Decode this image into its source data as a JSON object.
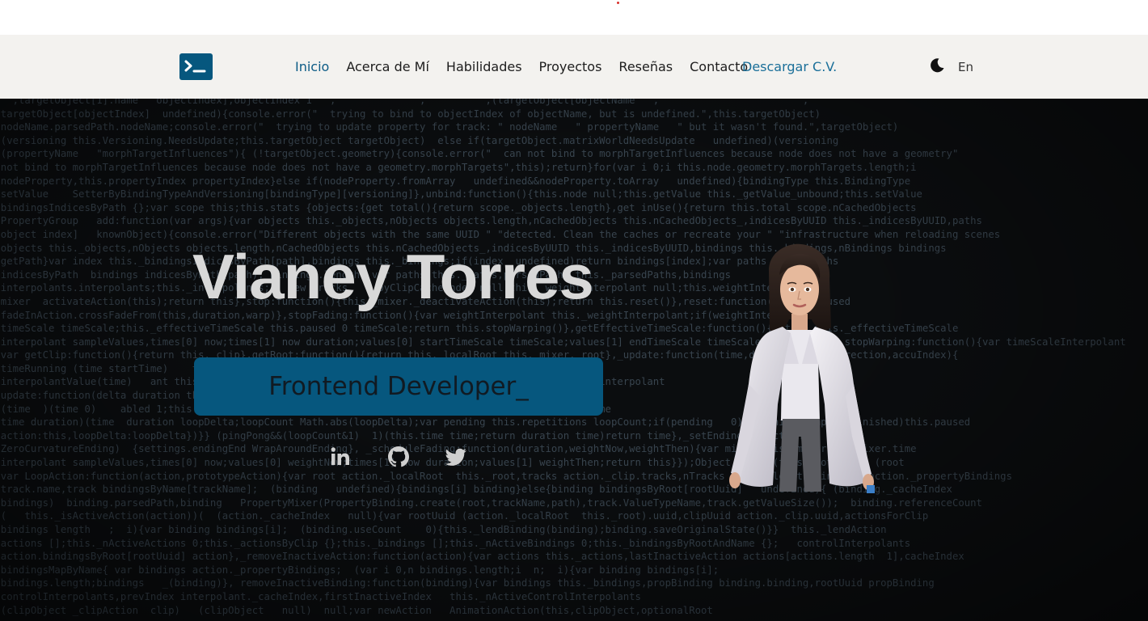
{
  "nav": {
    "logo_icon": "terminal-icon",
    "links": [
      {
        "label": "Inicio",
        "active": true
      },
      {
        "label": "Acerca de Mí",
        "active": false
      },
      {
        "label": "Habilidades",
        "active": false
      },
      {
        "label": "Proyectos",
        "active": false
      },
      {
        "label": "Reseñas",
        "active": false
      },
      {
        "label": "Contacto",
        "active": false
      }
    ],
    "cv_label": "Descargar C.V.",
    "theme_icon": "moon-icon",
    "lang_label": "En"
  },
  "hero": {
    "name": "Vianey Torres",
    "role": "Frontend Developer_",
    "social": [
      {
        "icon": "linkedin-icon"
      },
      {
        "icon": "github-icon"
      },
      {
        "icon": "twitter-icon"
      }
    ],
    "background_code": [
      "    ,targetObject[1].name   objectIndex],objectIndex 1   ,              ,          ,(targetObject[objectName   ,                        ,",
      "  targetObject[objectIndex]  undefined){console.error(\"  trying to bind to objectIndex of objectName, but is undefined.\",this.targetObject)",
      "  nodeName.parsedPath.nodeName;console.error(\"  trying to update property for track: \" nodeName   \" propertyName   \" but it wasn't found.\",targetObject)",
      "  (versioning this.Versioning.NeedsUpdate;this.targetObject targetObject)  else if(targetObject.matrixWorldNeedsUpdate   undefined)(versioning",
      "  (propertyName   \"morphTargetInfluences\"){ (!targetObject.geometry){console.error(\"  can not bind to morphTargetInfluences because node does not have a geometry\"",
      "  not bind to morphTargetInfluences because node does not have a geometry.morphTargets\",this);return}for(var i 0;i this.node.geometry.morphTargets.length;i",
      "  nodeProperty,this.propertyIndex propertyIndex}else if(nodeProperty.fromArray   undefined&&nodeProperty.toArray   undefined){bindingType this.BindingType",
      "  setValue    SetterByBindingTypeAndVersioning[bindingType][versioning]},unbind:function(){this.node null;this.getValue this._getValue_unbound;this.setValue",
      "  bindingsIndicesByPath {};var scope this;this.stats {objects:{get total(){return scope._objects.length},get inUse(){return this.total scope.nCachedObjects",
      "  PropertyGroup   add:function(var args){var objects this._objects,nObjects objects.length,nCachedObjects this.nCachedObjects_,indicesByUUID this._indicesByUUID,paths",
      "  object index]   knownObject){console.error(\"Different objects with the same UUID \" \"detected. Clean the caches or recreate your \" \"infrastructure when reloading scenes",
      "  objects this._objects,nObjects objects.length,nCachedObjects this.nCachedObjects_,indicesByUUID this._indicesByUUID,bindings this._bindings,nBindings bindings",
      "  getPath}var index this._bindingsIndicesByPath[path],bindings this._bindings;if(index  undefined)return bindings[index];var paths this._paths",
      "  indicesByPath  bindings indicesByPath(path); bindings.length  var paths this._paths,parsedPaths this._parsedPaths,bindings",
      "  interpolants.interpolants;this._interpolants;   new Tracks    _byClipCacheIndex null;this._weightInterpolant null;this.weightInterpolant",
      "  mixer  activateAction(this);return this},stop:function(){this._mixer._deactivateAction(this);return this.reset()},reset:function(){this.paused",
      "  fadeInAction.crossFadeFrom(this,duration,warp)},stopFading:function(){var weightInterpolant this._weightInterpolant;if(weightInterpolant",
      "  timeScale timeScale;this._effectiveTimeScale this.paused 0 timeScale;return this.stopWarping()},getEffectiveTimeScale:function(){return this._effectiveTimeScale",
      "  interpolant sampleValues,times[0] now;times[1] now duration;values[0] startTimeScale timeScale;values[1] endTimeScale timeScale;return this},stopWarping:function(){var timeScaleInterpolant",
      "  var getClip:function(){return this._clip},getRoot:function(){return this._localRoot this._mixer._root},_update:function(time,deltaTime,timeDirection,accuIndex){",
      "  timeRunning (time startTime)    timeRunning   _startTime null;deltaTime   timeRunning);deltaTime",
      "  interpolantValue(time)   ant this._timeScaleInterpolant;if(interpolant   null){var interpolantValue interpolant",
      "  update:function(delta duration this._clip.duration;loop this.loop,loopCount this._loopCount;if(loop",
      "  (time  )(time 0)    abled 1;this._mixer.dispatchEvent({type:\"finished\",action:this,direction:deltaTime",
      "  time duration)(time  duration loopDelta;loopCount Math.abs(loopDelta);var pending this.repetitions loopCount;if(pending   0){if(this.clampWhenFinished)this.paused",
      "  action:this,loopDelta:loopDelta})}} (pingPong&&(loopCount&1)  1)(this.time time;return duration time)return time},_setEndings:function(",
      "  ZeroCurvatureEnding)  {settings.endingEnd WrapAroundEnding}, _scheduleFading:function(duration,weightNow,weightThen){var mixer this._mixer,now mixer.time",
      "  interpolant sampleValues,times[0] now;values[0] weightNow;times[1] now duration;values[1] weightThen;return this}});Object.assign(this.prototype  (root",
      "  var LoopAction:function(action,prototypeAction){var root action._localRoot  this._root,tracks action._clip.tracks,nTracks tracks.length,bindings action._propertyBindings",
      "  track.name,track bindingsByName[trackName];  (binding   undefined){bindings[i] binding}else{binding bindingsByRoot[rootUuid]   undefined){ (binding._cacheIndex",
      "  bindings)  binding.parsedPath,binding   PropertyMixer(PropertyBinding.create(root,trackName,path),track.ValueTypeName,track.getValueSize());  binding.referenceCount",
      "  (   this._isActiveAction(action))(  (action._cacheIndex   null){var rootUuid (action._localRoot  this._root).uuid,clipUuid action._clip.uuid,actionsForClip",
      "  bindings length   ;  i){var binding bindings[i];  (binding.useCount    0){this._lendBinding(binding);binding.saveOriginalState()}}  this._lendAction",
      "  actions [];this._nActiveActions 0;this._actionsByClip {};this._bindings [];this._nActiveBindings 0;this._bindingsByRootAndName {};   controlInterpolants",
      "  action.bindingsByRoot[rootUuid] action},_removeInactiveAction:function(action){var actions this._actions,lastInactiveAction actions[actions.length  1],cacheIndex",
      "  bindingsMapByName{ var bindings action._propertyBindings;  (var i 0,n bindings.length;i  n;  i){var binding bindings[i];",
      "  bindings.length;bindings   _(binding)}, removeInactiveBinding:function(binding){var bindings this._bindings,propBinding binding.binding,rootUuid propBinding",
      "  controlInterpolants,prevIndex interpolant._cacheIndex,firstInactiveIndex   this._nActiveControlInterpolants",
      "  (clipObject _clipAction  clip)   (clipObject   null)  null;var newAction   AnimationAction(this,clipObject,optionalRoot"
    ]
  }
}
